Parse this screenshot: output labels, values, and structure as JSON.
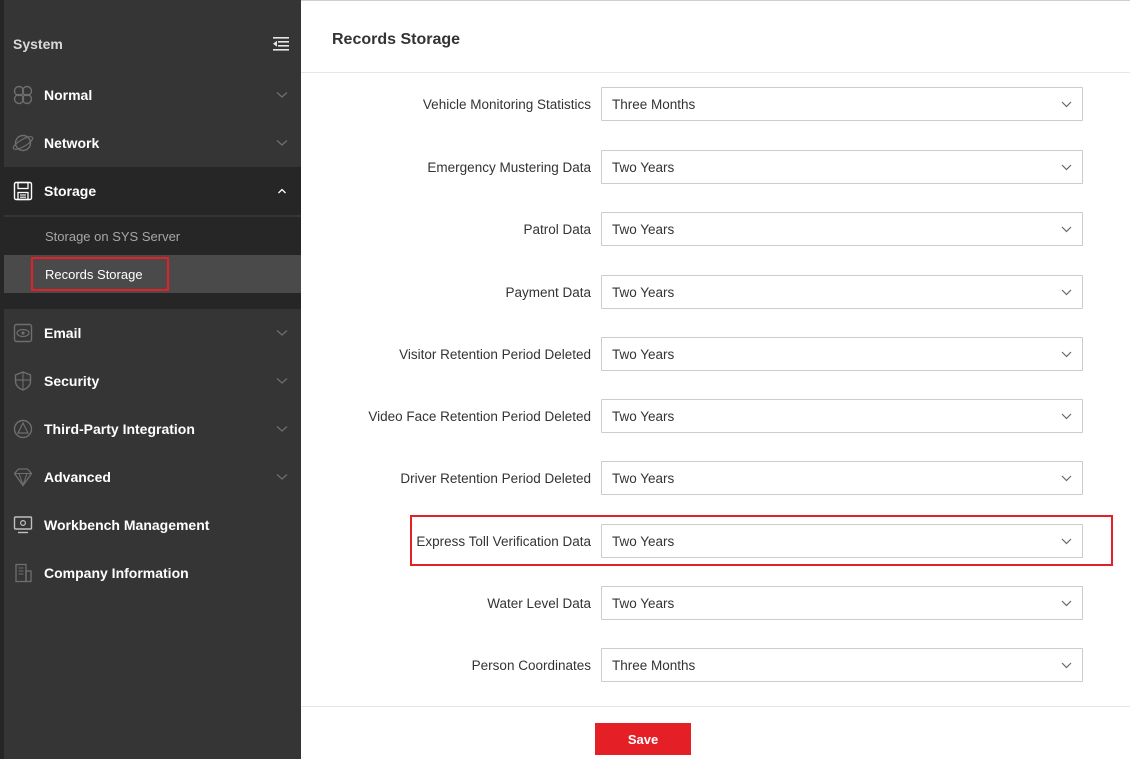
{
  "sidebar": {
    "title": "System",
    "items": [
      {
        "label": "Normal",
        "icon": "normal-icon"
      },
      {
        "label": "Network",
        "icon": "network-icon"
      },
      {
        "label": "Storage",
        "icon": "storage-icon",
        "expanded": true,
        "children": [
          {
            "label": "Storage on SYS Server"
          },
          {
            "label": "Records Storage",
            "active": true
          }
        ]
      },
      {
        "label": "Email",
        "icon": "email-icon"
      },
      {
        "label": "Security",
        "icon": "security-icon"
      },
      {
        "label": "Third-Party Integration",
        "icon": "third-party-icon"
      },
      {
        "label": "Advanced",
        "icon": "advanced-icon"
      },
      {
        "label": "Workbench Management",
        "icon": "workbench-icon"
      },
      {
        "label": "Company Information",
        "icon": "company-icon"
      }
    ]
  },
  "main": {
    "title": "Records Storage",
    "fields": [
      {
        "label": "Vehicle Monitoring Statistics",
        "value": "Three Months"
      },
      {
        "label": "Emergency Mustering Data",
        "value": "Two Years"
      },
      {
        "label": "Patrol Data",
        "value": "Two Years"
      },
      {
        "label": "Payment Data",
        "value": "Two Years"
      },
      {
        "label": "Visitor Retention Period Deleted",
        "value": "Two Years"
      },
      {
        "label": "Video Face Retention Period Deleted",
        "value": "Two Years"
      },
      {
        "label": "Driver Retention Period Deleted",
        "value": "Two Years"
      },
      {
        "label": "Express Toll Verification Data",
        "value": "Two Years"
      },
      {
        "label": "Water Level Data",
        "value": "Two Years"
      },
      {
        "label": "Person Coordinates",
        "value": "Three Months"
      }
    ],
    "save_label": "Save"
  },
  "colors": {
    "accent": "#e41f26",
    "sidebar_bg": "#353535",
    "sidebar_active_bg": "#262626"
  }
}
